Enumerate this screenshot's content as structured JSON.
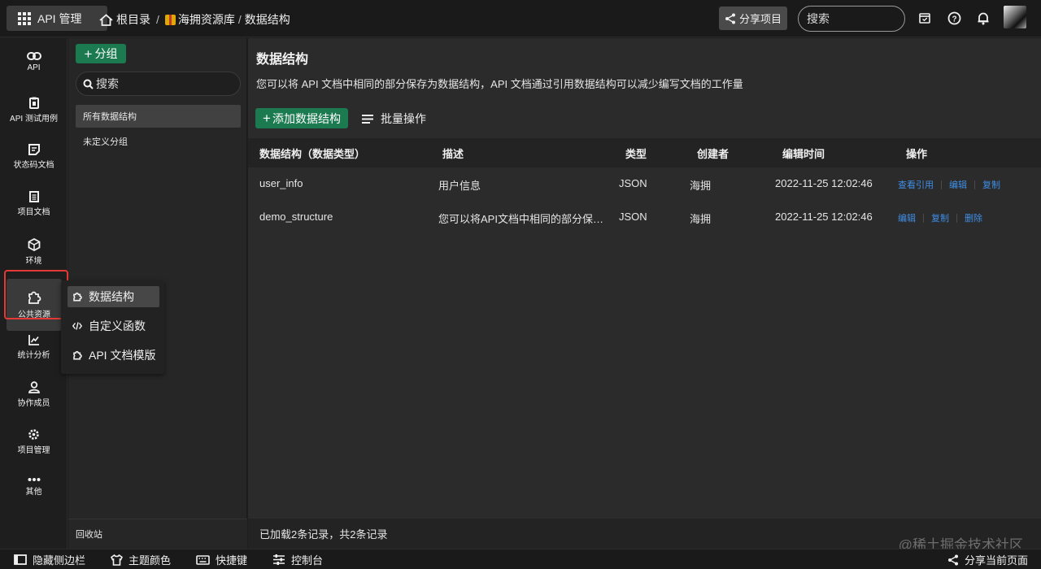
{
  "topbar": {
    "app_button": "API 管理",
    "breadcrumb": [
      "根目录",
      "海拥资源库",
      "数据结构"
    ],
    "share_project": "分享项目",
    "search_placeholder": "搜索"
  },
  "rail": {
    "items": [
      {
        "label": "API",
        "icon": "link-icon"
      },
      {
        "label": "API 测试用例",
        "icon": "test-case-icon"
      },
      {
        "label": "状态码文档",
        "icon": "status-code-icon"
      },
      {
        "label": "项目文档",
        "icon": "document-icon"
      },
      {
        "label": "环境",
        "icon": "environment-icon"
      },
      {
        "label": "公共资源",
        "icon": "puzzle-icon"
      },
      {
        "label": "统计分析",
        "icon": "chart-icon"
      },
      {
        "label": "协作成员",
        "icon": "user-icon"
      },
      {
        "label": "项目管理",
        "icon": "gear-icon"
      },
      {
        "label": "其他",
        "icon": "more-icon"
      }
    ],
    "active_index": 5
  },
  "flyout": {
    "items": [
      "数据结构",
      "自定义函数",
      "API 文档模版"
    ],
    "active_index": 0
  },
  "group_panel": {
    "add_group": "分组",
    "search_placeholder": "搜索",
    "groups": [
      "所有数据结构",
      "未定义分组"
    ],
    "recycle_bin": "回收站"
  },
  "main": {
    "title": "数据结构",
    "description": "您可以将 API 文档中相同的部分保存为数据结构，API 文档通过引用数据结构可以减少编写文档的工作量",
    "add_button": "添加数据结构",
    "batch_button": "批量操作",
    "columns": [
      "数据结构（数据类型）",
      "描述",
      "类型",
      "创建者",
      "编辑时间",
      "操作"
    ],
    "rows": [
      {
        "name": "user_info",
        "desc": "用户信息",
        "type": "JSON",
        "creator": "海拥",
        "time": "2022-11-25 12:02:46",
        "ops": [
          "查看引用",
          "编辑",
          "复制"
        ]
      },
      {
        "name": "demo_structure",
        "desc": "您可以将API文档中相同的部分保…",
        "type": "JSON",
        "creator": "海拥",
        "time": "2022-11-25 12:02:46",
        "ops": [
          "编辑",
          "复制",
          "删除"
        ]
      }
    ],
    "footer": "已加载2条记录，共2条记录"
  },
  "bottombar": {
    "hide_sidebar": "隐藏侧边栏",
    "theme": "主题颜色",
    "shortcuts": "快捷键",
    "console": "控制台",
    "share_page": "分享当前页面"
  },
  "watermark": "@稀土掘金技术社区",
  "colors": {
    "accent_green": "#1b7a4f",
    "link_blue": "#3f8ee6",
    "highlight_red": "#e53935"
  }
}
